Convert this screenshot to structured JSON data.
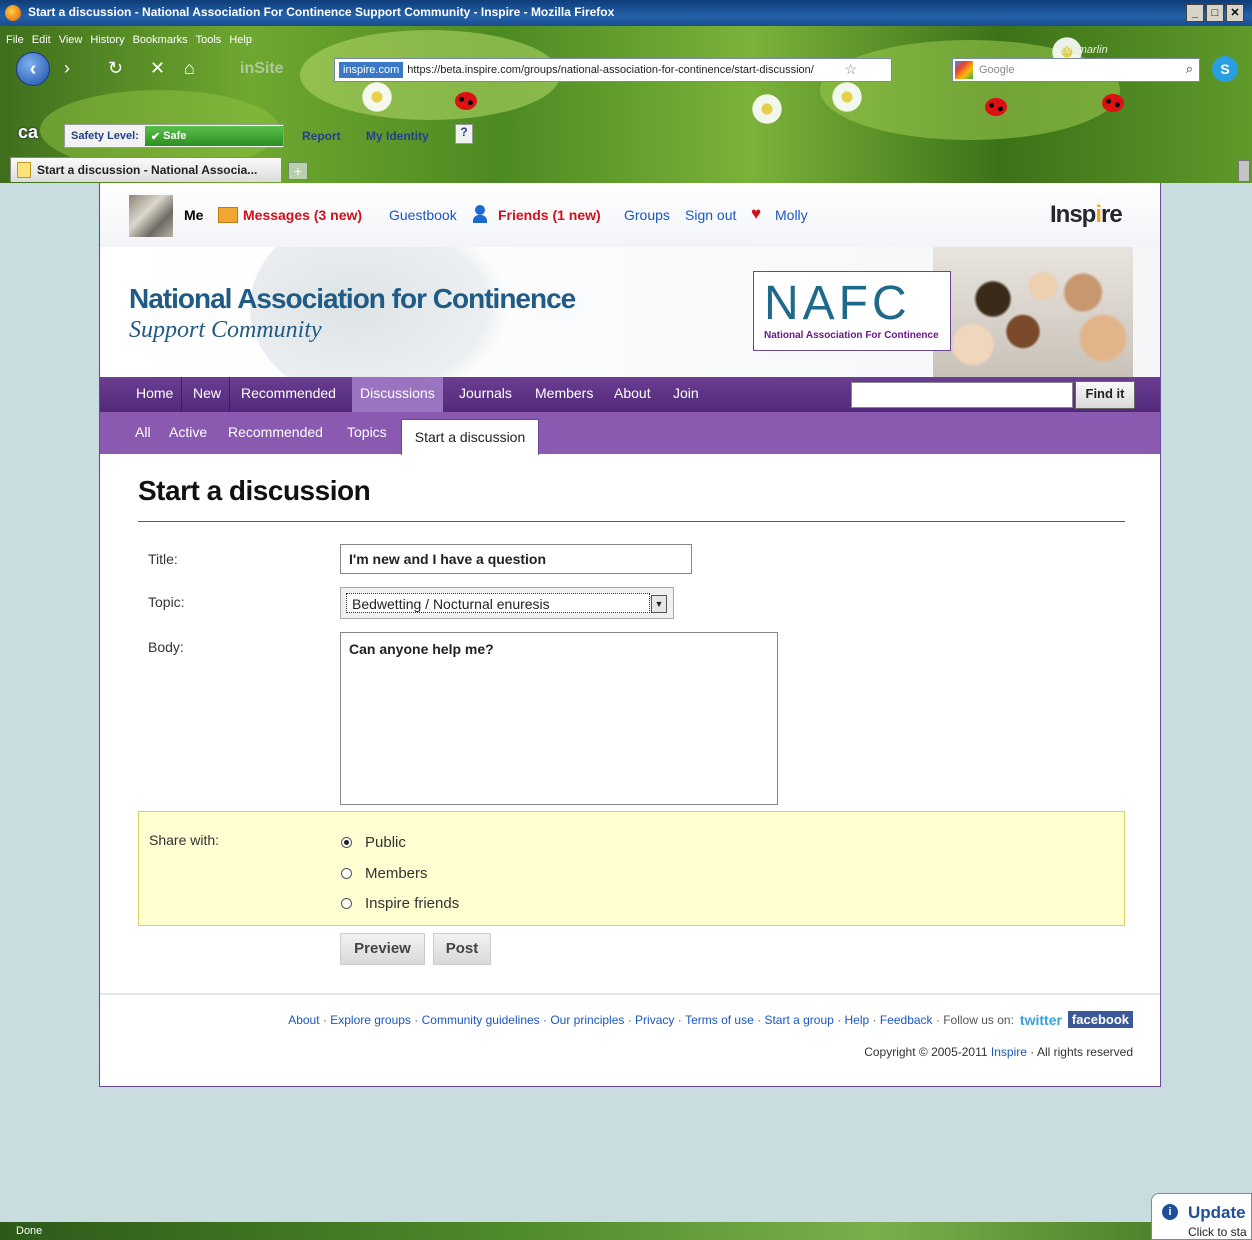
{
  "browser": {
    "window_title": "Start a discussion - National Association For Continence Support Community - Inspire - Mozilla Firefox",
    "menu": [
      "File",
      "Edit",
      "View",
      "History",
      "Bookmarks",
      "Tools",
      "Help"
    ],
    "insite_label": "inSite",
    "site_badge": "inspire.com",
    "url": "https://beta.inspire.com/groups/national-association-for-continence/start-discussion/",
    "search_placeholder": "Google",
    "theme_name": "zedmarlin",
    "safety_label": "Safety Level:",
    "safety_value": "Safe",
    "report_label": "Report",
    "identity_label": "My Identity",
    "help_label": "?",
    "tab_title": "Start a discussion - National Associa...",
    "new_tab": "+",
    "status": "Done",
    "update_title": "Update",
    "update_sub": "Click to sta"
  },
  "userbar": {
    "me": "Me",
    "messages": "Messages (3 new)",
    "guestbook": "Guestbook",
    "friends": "Friends (1 new)",
    "groups": "Groups",
    "sign_out": "Sign out",
    "molly": "Molly",
    "logo_a": "Insp",
    "logo_b": "i",
    "logo_c": "re"
  },
  "banner": {
    "org_line1": "National Association for Continence",
    "org_line2": "Support Community",
    "nafc": "NAFC",
    "nafc_sub": "National Association For Continence"
  },
  "nav": {
    "items": [
      "Home",
      "New",
      "Recommended",
      "Discussions",
      "Journals",
      "Members",
      "About",
      "Join"
    ],
    "active": "Discussions",
    "find_button": "Find it",
    "find_value": ""
  },
  "subnav": {
    "items": [
      "All",
      "Active",
      "Recommended",
      "Topics"
    ],
    "active_tab": "Start a discussion"
  },
  "form": {
    "heading": "Start a discussion",
    "title_label": "Title:",
    "title_value": "I'm new and I have a question",
    "topic_label": "Topic:",
    "topic_value": "Bedwetting / Nocturnal enuresis",
    "body_label": "Body:",
    "body_value": "Can anyone help me?",
    "share_label": "Share with:",
    "share_options": [
      "Public",
      "Members",
      "Inspire friends"
    ],
    "share_selected": "Public",
    "preview_button": "Preview",
    "post_button": "Post"
  },
  "footer": {
    "links": [
      "About",
      "Explore groups",
      "Community guidelines",
      "Our principles",
      "Privacy",
      "Terms of use",
      "Start a group",
      "Help",
      "Feedback"
    ],
    "follow_label": "Follow us on:",
    "twitter": "twitter",
    "facebook": "facebook",
    "copyright": "Copyright © 2005-2011",
    "copyright_link": "Inspire",
    "rights": "· All rights reserved"
  },
  "colors": {
    "nav_purple": "#5e3288",
    "subnav_purple": "#8a5ab0",
    "link_blue": "#1a56c0",
    "alert_red": "#d0101a",
    "org_blue": "#1f5b84",
    "share_bg": "#ffffd2"
  }
}
